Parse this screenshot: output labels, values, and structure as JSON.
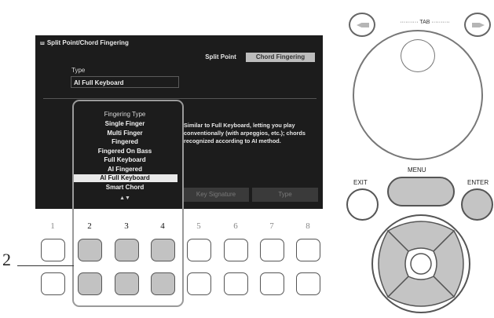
{
  "screen": {
    "title": "Split Point/Chord Fingering",
    "title_icon": "keyboard-glyph",
    "tabs": [
      "Split Point",
      "Chord Fingering"
    ],
    "active_tab": "Chord Fingering",
    "type_label": "Type",
    "type_value": "AI Full Keyboard",
    "list_header": "Fingering Type",
    "fingering_types": [
      "Single Finger",
      "Multi Finger",
      "Fingered",
      "Fingered On Bass",
      "Full Keyboard",
      "AI Fingered",
      "AI Full Keyboard",
      "Smart Chord"
    ],
    "selected_index": 6,
    "scroll_arrows": "▲▼",
    "description": "Similar to Full Keyboard, letting you play conventionally (with arpeggios, etc.); chords recognized according to AI method.",
    "bottom_buttons": [
      "Key Signature",
      "Type"
    ]
  },
  "panel": {
    "button_numbers": [
      "1",
      "2",
      "3",
      "4",
      "5",
      "6",
      "7",
      "8"
    ],
    "highlighted_columns": [
      2,
      3,
      4
    ],
    "callout_number": "2",
    "tab_label": "TAB",
    "exit_label": "EXIT",
    "menu_label": "MENU",
    "enter_label": "ENTER"
  }
}
